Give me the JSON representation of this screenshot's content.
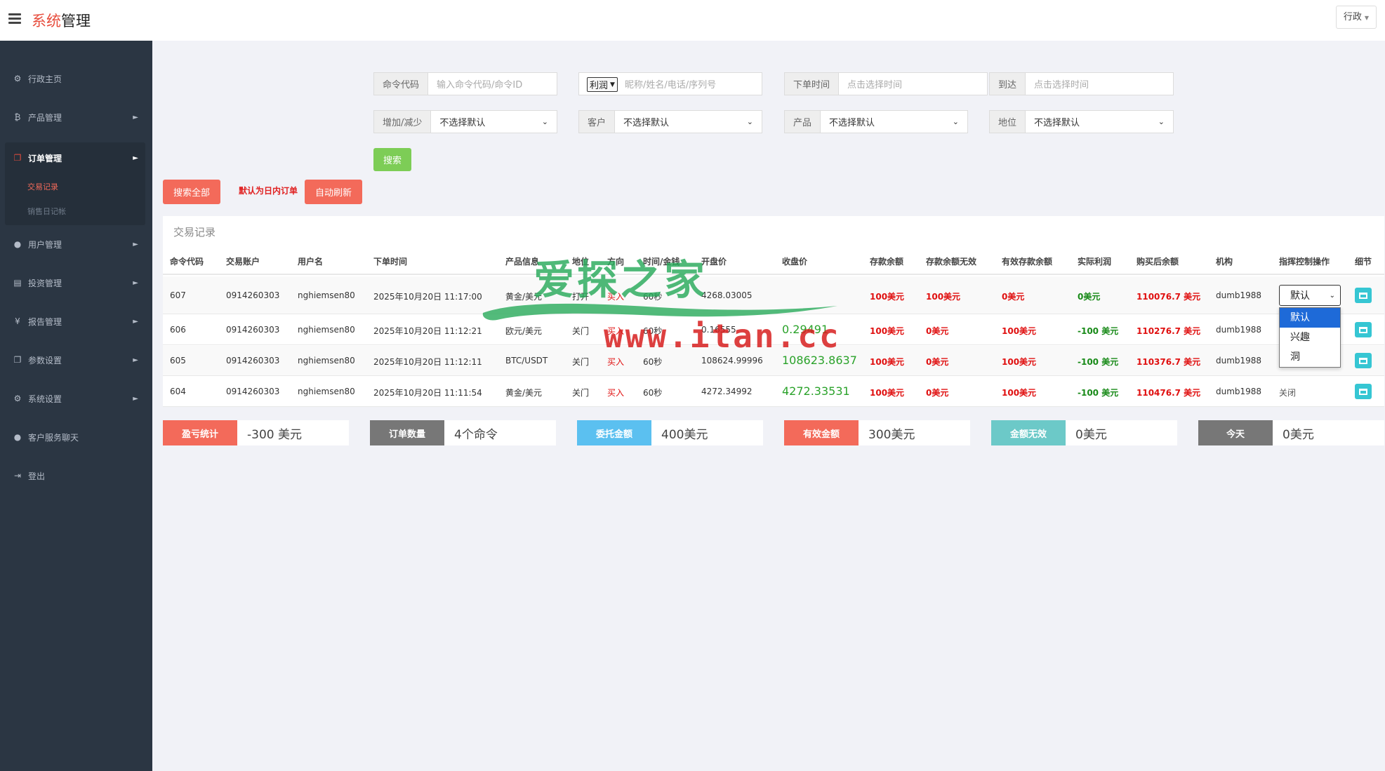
{
  "header": {
    "brand_part1": "系统",
    "brand_part2": "管理",
    "user_menu": "行政"
  },
  "sidebar": {
    "items": [
      {
        "icon": "dashboard-icon",
        "glyph": "⚙",
        "label": "行政主页"
      },
      {
        "icon": "bitcoin-icon",
        "glyph": "₿",
        "label": "产品管理"
      },
      {
        "icon": "files-icon",
        "glyph": "❐",
        "label": "订单管理"
      },
      {
        "icon": "user-icon",
        "glyph": "●",
        "label": "用户管理"
      },
      {
        "icon": "book-icon",
        "glyph": "▤",
        "label": "投资管理"
      },
      {
        "icon": "yen-icon",
        "glyph": "¥",
        "label": "报告管理"
      },
      {
        "icon": "copy-icon",
        "glyph": "❐",
        "label": "参数设置"
      },
      {
        "icon": "cogs-icon",
        "glyph": "⚙",
        "label": "系统设置"
      },
      {
        "icon": "chat-icon",
        "glyph": "●",
        "label": "客户服务聊天"
      },
      {
        "icon": "logout-icon",
        "glyph": "⇥",
        "label": "登出"
      }
    ],
    "sub_items": [
      "交易记录",
      "销售日记帐"
    ]
  },
  "filters": {
    "order_code_label": "命令代码",
    "order_code_placeholder": "输入命令代码/命令ID",
    "profit_select": "利润",
    "customer_search_placeholder": "昵称/姓名/电话/序列号",
    "order_time_label": "下单时间",
    "order_time_placeholder": "点击选择时间",
    "to_label": "到达",
    "to_placeholder": "点击选择时间",
    "inc_dec_label": "增加/减少",
    "customer_label": "客户",
    "product_label": "产品",
    "position_label": "地位",
    "default_option": "不选择默认",
    "search_button": "搜索"
  },
  "actions": {
    "search_all": "搜索全部",
    "default_note": "默认为日内订单",
    "auto_refresh": "自动刷新"
  },
  "table": {
    "title": "交易记录",
    "headers": [
      "命令代码",
      "交易账户",
      "用户名",
      "下单时间",
      "产品信息",
      "地位",
      "方向",
      "时间/金钱",
      "开盘价",
      "收盘价",
      "存款余额",
      "存款余额无效",
      "有效存款余额",
      "实际利润",
      "购买后余额",
      "机构",
      "指挥控制操作",
      "细节"
    ],
    "rows": [
      [
        "607",
        "0914260303",
        "nghiemsen80",
        "2025年10月20日 11:17:00",
        "黄金/美元",
        "打开",
        "买入",
        "60秒",
        "4268.03005",
        "",
        "100美元",
        "100美元",
        "0美元",
        "0美元",
        "110076.7 美元",
        "dumb1988",
        "默认"
      ],
      [
        "606",
        "0914260303",
        "nghiemsen80",
        "2025年10月20日 11:12:21",
        "欧元/美元",
        "关门",
        "买入",
        "60秒",
        "0.16555",
        "0.29491",
        "100美元",
        "0美元",
        "100美元",
        "-100 美元",
        "110276.7 美元",
        "dumb1988",
        ""
      ],
      [
        "605",
        "0914260303",
        "nghiemsen80",
        "2025年10月20日 11:12:11",
        "BTC/USDT",
        "关门",
        "买入",
        "60秒",
        "108624.99996",
        "108623.8637",
        "100美元",
        "0美元",
        "100美元",
        "-100 美元",
        "110376.7 美元",
        "dumb1988",
        ""
      ],
      [
        "604",
        "0914260303",
        "nghiemsen80",
        "2025年10月20日 11:11:54",
        "黄金/美元",
        "关门",
        "买入",
        "60秒",
        "4272.34992",
        "4272.33531",
        "100美元",
        "0美元",
        "100美元",
        "-100 美元",
        "110476.7 美元",
        "dumb1988",
        "关闭"
      ]
    ],
    "dropdown_options": [
      "默认",
      "兴趣",
      "洞"
    ]
  },
  "stats": [
    {
      "label": "盈亏统计",
      "value": "-300 美元",
      "color": "#f36a5a"
    },
    {
      "label": "订单数量",
      "value": "4个命令",
      "color": "#777777"
    },
    {
      "label": "委托金额",
      "value": "400美元",
      "color": "#5bc0f0"
    },
    {
      "label": "有效金额",
      "value": "300美元",
      "color": "#f36a5a"
    },
    {
      "label": "金额无效",
      "value": "0美元",
      "color": "#6cc9c8"
    },
    {
      "label": "今天",
      "value": "0美元",
      "color": "#777777"
    }
  ],
  "watermark": {
    "title": "爱探之家",
    "url": "www.itan.cc"
  },
  "colors": {
    "sidebar": "#2b3643",
    "accent_red": "#f36a5a",
    "green_button": "#7dcd56",
    "detail_button": "#36c6d3"
  }
}
